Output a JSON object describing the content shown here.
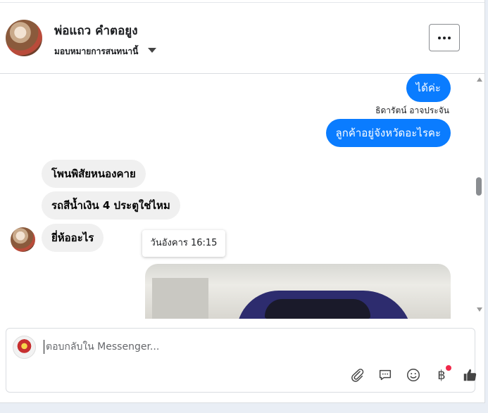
{
  "header": {
    "contact_name": "พ่อแถว คำตอยูง",
    "assign_label": "มอบหมายการสนทนานี้",
    "more_label": "..."
  },
  "messages": {
    "out_1": "ได้ค่ะ",
    "sender_name": "ธิดารัตน์ อาจประจัน",
    "out_2": "ลูกค้าอยู่จังหวัดอะไรคะ",
    "in_1": "โพนพิสัยหนองคาย",
    "in_2": "รถสีน้ำเงิน 4 ประตูใช่ไหม",
    "in_3": "ยี่ห้ออะไร",
    "timestamp_tooltip": "วันอังคาร 16:15"
  },
  "composer": {
    "placeholder": "ตอบกลับใน Messenger...",
    "tools": [
      "attach-icon",
      "comment-icon",
      "emoji-icon",
      "baht-icon",
      "like-icon"
    ],
    "baht_symbol": "฿"
  },
  "colors": {
    "outgoing_bubble": "#0a7cff",
    "incoming_bubble": "#f0f0f0",
    "notification_dot": "#f0284a"
  }
}
